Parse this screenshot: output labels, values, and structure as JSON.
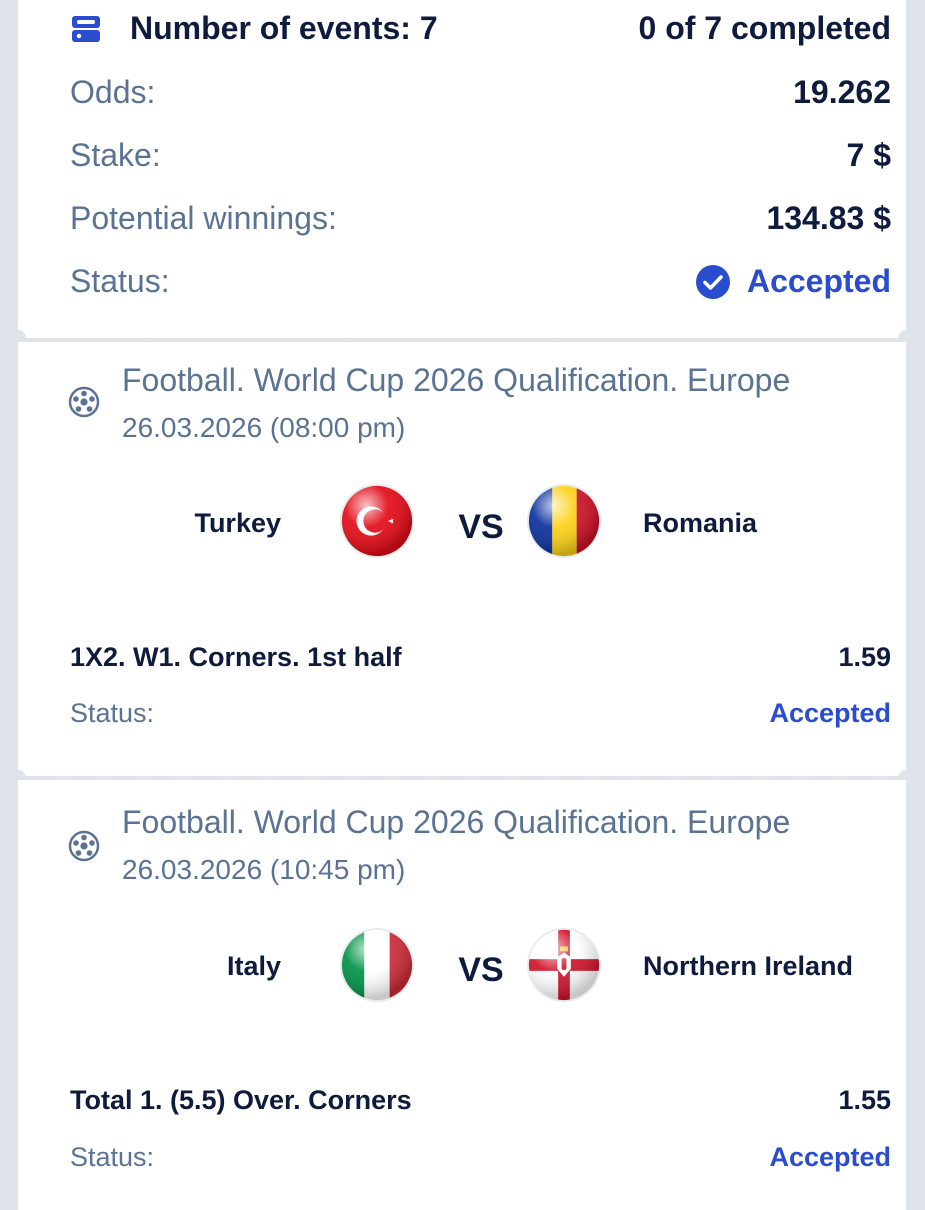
{
  "summary": {
    "events_label": "Number of events: 7",
    "completed_label": "0 of 7 completed",
    "odds_label": "Odds:",
    "odds_value": "19.262",
    "stake_label": "Stake:",
    "stake_value": "7 $",
    "winnings_label": "Potential winnings:",
    "winnings_value": "134.83 $",
    "status_label": "Status:",
    "status_value": "Accepted",
    "status_color": "#2a4dd0"
  },
  "events": [
    {
      "league": "Football. World Cup 2026 Qualification. Europe",
      "datetime": "26.03.2026 (08:00 pm)",
      "home_team": "Turkey",
      "away_team": "Romania",
      "home_flag_icon": "turkey-flag-icon",
      "away_flag_icon": "romania-flag-icon",
      "vs": "VS",
      "bet": "1X2. W1. Corners. 1st half",
      "odds": "1.59",
      "status_label": "Status:",
      "status_value": "Accepted"
    },
    {
      "league": "Football. World Cup 2026 Qualification. Europe",
      "datetime": "26.03.2026 (10:45 pm)",
      "home_team": "Italy",
      "away_team": "Northern Ireland",
      "home_flag_icon": "italy-flag-icon",
      "away_flag_icon": "northern-ireland-flag-icon",
      "vs": "VS",
      "bet": "Total 1. (5.5) Over. Corners",
      "odds": "1.55",
      "status_label": "Status:",
      "status_value": "Accepted"
    }
  ],
  "colors": {
    "text_dark": "#0f1b3d",
    "text_muted": "#5b7393",
    "accent_blue": "#2a4dd0",
    "background": "#dfe4ea"
  }
}
